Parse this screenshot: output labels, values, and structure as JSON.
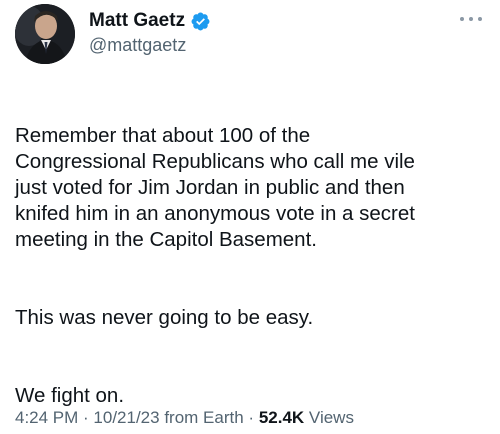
{
  "author": {
    "display_name": "Matt Gaetz",
    "handle": "@mattgaetz",
    "verified": true,
    "verified_color": "#1d9bf0"
  },
  "tweet": {
    "paragraphs": [
      "Remember that about 100 of the\nCongressional Republicans who call me vile\njust voted for Jim Jordan in public and then\nknifed him in an anonymous vote in a secret\nmeeting in the Capitol Basement.",
      "This was never going to be easy.",
      "We fight on."
    ]
  },
  "meta": {
    "time": "4:24 PM",
    "sep1": " · ",
    "date": "10/21/23",
    "source": " from Earth",
    "sep2": " · ",
    "views_count": "52.4K",
    "views_label": " Views"
  },
  "icons": {
    "more": "more-horizontal-icon",
    "verified": "verified-badge-icon"
  }
}
